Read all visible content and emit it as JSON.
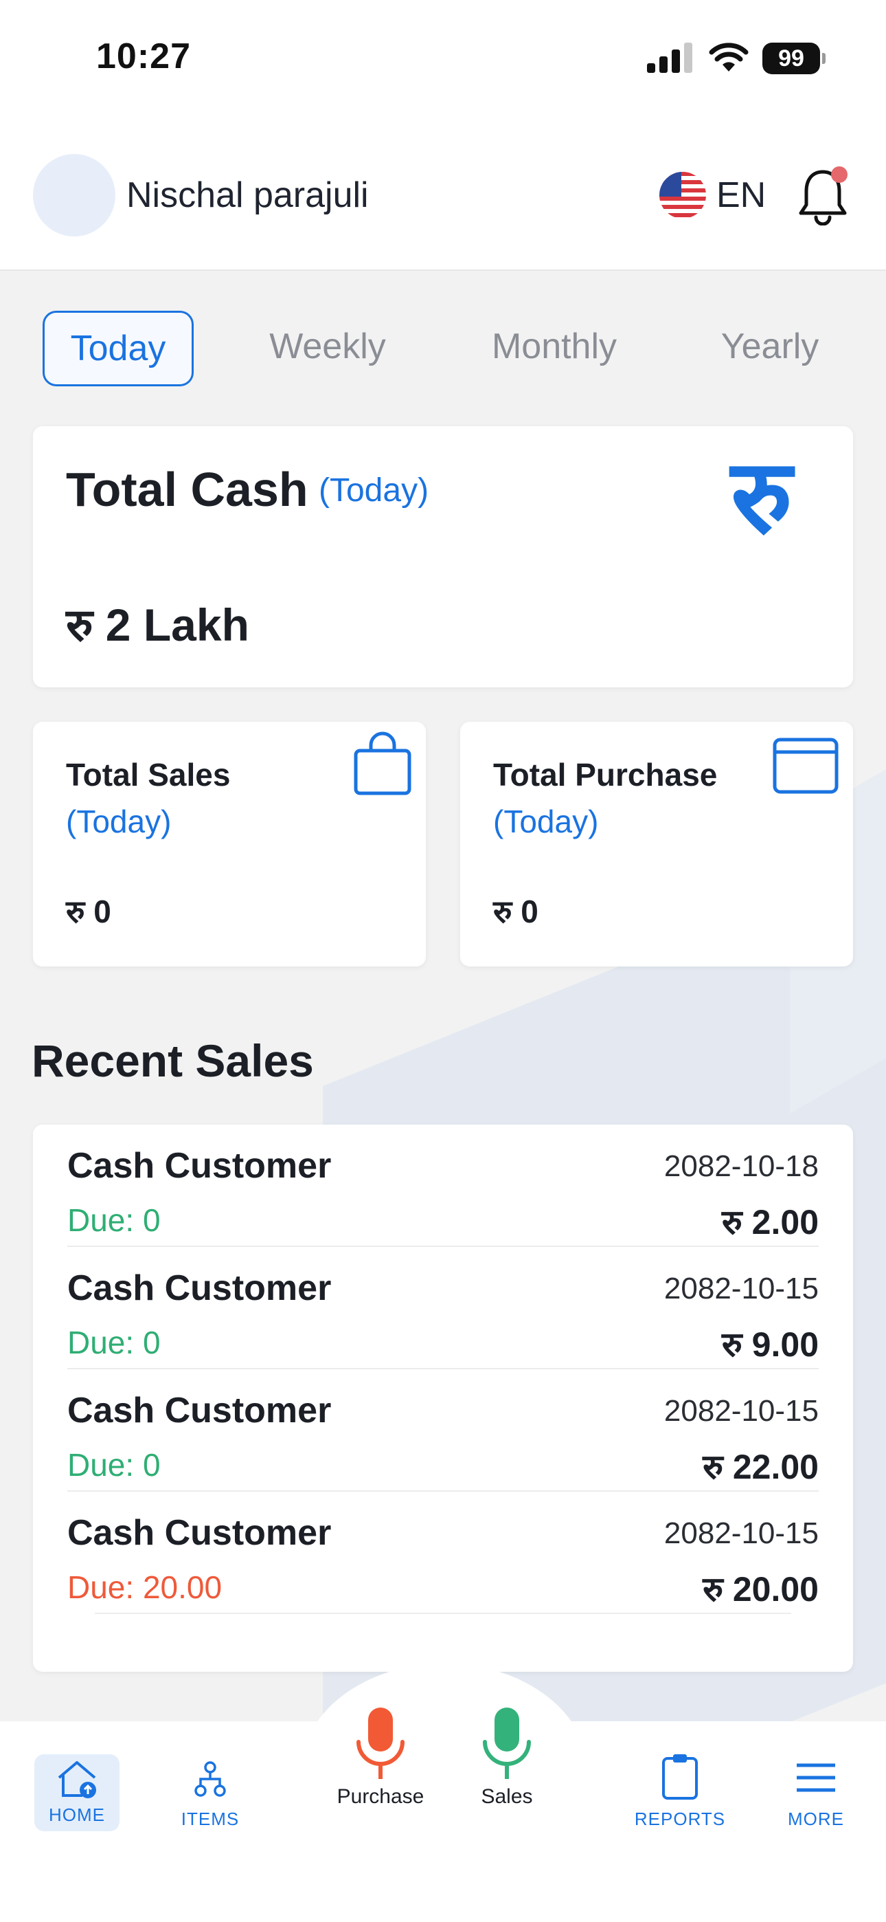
{
  "status_bar": {
    "time": "10:27",
    "battery": "99"
  },
  "header": {
    "user_name": "Nischal parajuli",
    "language": "EN"
  },
  "tabs": [
    {
      "label": "Today",
      "active": true
    },
    {
      "label": "Weekly",
      "active": false
    },
    {
      "label": "Monthly",
      "active": false
    },
    {
      "label": "Yearly",
      "active": false
    }
  ],
  "total_cash": {
    "title": "Total Cash",
    "period": "(Today)",
    "value": "रु 2 Lakh",
    "icon_glyph": "रु"
  },
  "total_sales": {
    "title": "Total Sales",
    "period": "(Today)",
    "value": "रु 0"
  },
  "total_purchase": {
    "title": "Total Purchase",
    "period": "(Today)",
    "value": "रु 0"
  },
  "recent_sales": {
    "title": "Recent Sales",
    "items": [
      {
        "customer": "Cash Customer",
        "date": "2082-10-18",
        "due": "Due: 0",
        "amount": "रु 2.00",
        "due_status": "paid"
      },
      {
        "customer": "Cash Customer",
        "date": "2082-10-15",
        "due": "Due: 0",
        "amount": "रु 9.00",
        "due_status": "paid"
      },
      {
        "customer": "Cash Customer",
        "date": "2082-10-15",
        "due": "Due: 0",
        "amount": "रु 22.00",
        "due_status": "paid"
      },
      {
        "customer": "Cash Customer",
        "date": "2082-10-15",
        "due": "Due: 20.00",
        "amount": "रु 20.00",
        "due_status": "due"
      }
    ]
  },
  "bottom_nav": {
    "home": "HOME",
    "items": "ITEMS",
    "purchase": "Purchase",
    "sales": "Sales",
    "reports": "REPORTS",
    "more": "MORE"
  },
  "colors": {
    "accent": "#1a73e0",
    "paid": "#2fae74",
    "due": "#ee5a3a",
    "purchase_mic": "#f15a35",
    "sales_mic": "#34b27b"
  },
  "icons": {
    "avatar": "avatar",
    "flag": "us-flag-icon",
    "notification": "bell-icon",
    "cash": "rupee-icon",
    "sales": "shopping-bag-icon",
    "purchase": "wallet-icon",
    "home": "home-icon",
    "items": "hierarchy-icon",
    "purchase_voice": "microphone-icon",
    "sales_voice": "microphone-icon",
    "reports": "clipboard-icon",
    "more": "menu-icon"
  }
}
